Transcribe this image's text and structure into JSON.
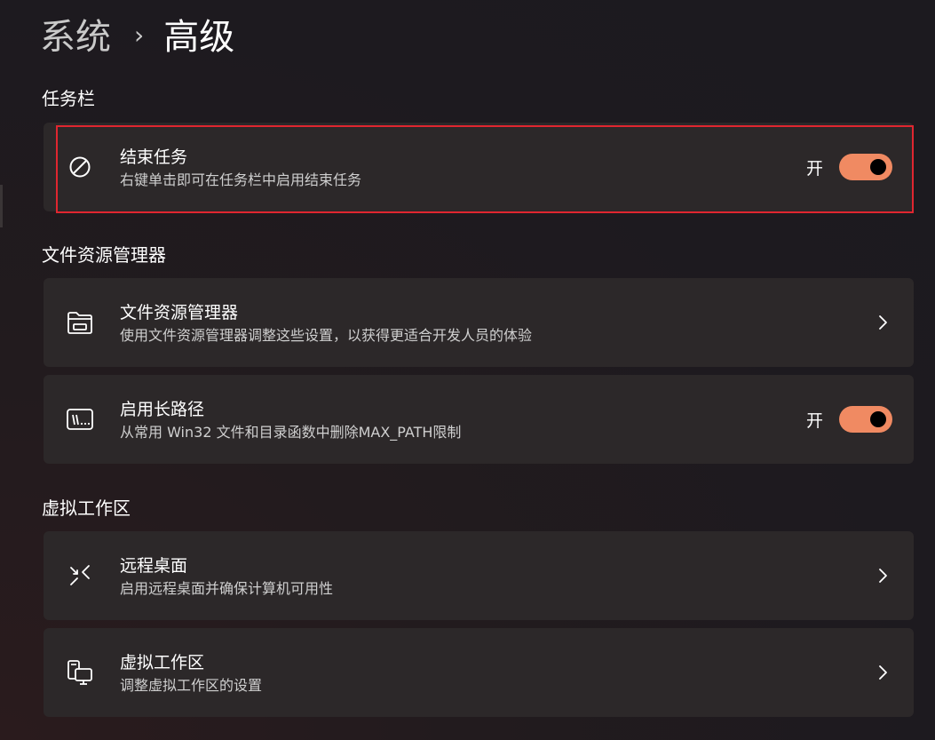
{
  "breadcrumb": {
    "parent": "系统",
    "separator": "›",
    "current": "高级"
  },
  "sections": {
    "taskbar": {
      "title": "任务栏",
      "end_task": {
        "title": "结束任务",
        "description": "右键单击即可在任务栏中启用结束任务",
        "toggle_label": "开",
        "toggle_on": true,
        "icon": "prohibited-icon"
      }
    },
    "file_explorer": {
      "title": "文件资源管理器",
      "explorer": {
        "title": "文件资源管理器",
        "description": "使用文件资源管理器调整这些设置，以获得更适合开发人员的体验",
        "icon": "folder-icon"
      },
      "long_paths": {
        "title": "启用长路径",
        "description": "从常用 Win32 文件和目录函数中删除MAX_PATH限制",
        "toggle_label": "开",
        "toggle_on": true,
        "icon": "long-path-icon"
      }
    },
    "virtual_workspaces": {
      "title": "虚拟工作区",
      "remote_desktop": {
        "title": "远程桌面",
        "description": "启用远程桌面并确保计算机可用性",
        "icon": "remote-desktop-icon"
      },
      "virtual_workspace": {
        "title": "虚拟工作区",
        "description": "调整虚拟工作区的设置",
        "icon": "virtual-workspace-icon"
      }
    }
  },
  "colors": {
    "toggle_on": "#f08a62",
    "card_background": "#2c2829",
    "highlight_border": "#e02630"
  }
}
